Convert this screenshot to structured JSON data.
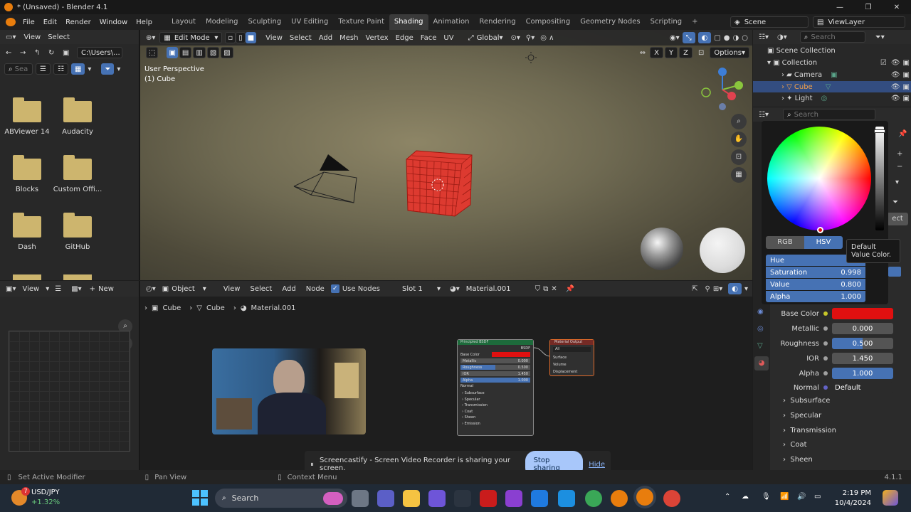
{
  "window": {
    "title": "* (Unsaved) - Blender 4.1"
  },
  "menu": [
    "File",
    "Edit",
    "Render",
    "Window",
    "Help"
  ],
  "workspaces": [
    "Layout",
    "Modeling",
    "Sculpting",
    "UV Editing",
    "Texture Paint",
    "Shading",
    "Animation",
    "Rendering",
    "Compositing",
    "Geometry Nodes",
    "Scripting"
  ],
  "active_workspace": "Shading",
  "scene": "Scene",
  "viewlayer": "ViewLayer",
  "filebrowser": {
    "view_label": "View",
    "select_label": "Select",
    "path": "C:\\Users\\...",
    "search_placeholder": "Sea",
    "folders": [
      "ABViewer 14",
      "Audacity",
      "Blocks",
      "Custom Offi...",
      "Dash",
      "GitHub"
    ]
  },
  "viewport": {
    "mode": "Edit Mode",
    "menus": [
      "View",
      "Select",
      "Add",
      "Mesh",
      "Vertex",
      "Edge",
      "Face",
      "UV"
    ],
    "orientation": "Global",
    "options_label": "Options",
    "overlay_line1": "User Perspective",
    "overlay_line2": "(1) Cube",
    "axes": [
      "X",
      "Y",
      "Z"
    ]
  },
  "outliner": {
    "search_placeholder": "Search",
    "root": "Scene Collection",
    "items": [
      "Collection",
      "Camera",
      "Cube",
      "Light"
    ]
  },
  "properties": {
    "search_placeholder": "Search",
    "mode_tabs": [
      "RGB",
      "HSV"
    ],
    "tooltip": "Default Value Color.",
    "hsv_fields": [
      {
        "label": "Hue",
        "value": "0"
      },
      {
        "label": "Saturation",
        "value": "0.998"
      },
      {
        "label": "Value",
        "value": "0.800"
      },
      {
        "label": "Alpha",
        "value": "1.000"
      }
    ],
    "rows": [
      {
        "label": "Base Color",
        "value": ""
      },
      {
        "label": "Metallic",
        "value": "0.000"
      },
      {
        "label": "Roughness",
        "value": "0.500"
      },
      {
        "label": "IOR",
        "value": "1.450"
      },
      {
        "label": "Alpha",
        "value": "1.000"
      },
      {
        "label": "Normal",
        "value": "Default"
      }
    ],
    "sections": [
      "Subsurface",
      "Specular",
      "Transmission",
      "Coat",
      "Sheen"
    ],
    "base_color": "#e01010",
    "side_label": "ect"
  },
  "image_editor": {
    "view_label": "View",
    "new_label": "New"
  },
  "node_editor": {
    "type": "Object",
    "menus": [
      "View",
      "Select",
      "Add",
      "Node"
    ],
    "use_nodes": "Use Nodes",
    "slot": "Slot 1",
    "material": "Material.001",
    "breadcrumb": [
      "Cube",
      "Cube",
      "Material.001"
    ],
    "bsdf": {
      "title": "Principled BSDF",
      "out": "BSDF",
      "rows": [
        "Base Color",
        "Metallic",
        "Roughness",
        "IOR",
        "Alpha",
        "Normal"
      ],
      "values": [
        "",
        "0.000",
        "0.500",
        "1.450",
        "1.000",
        ""
      ],
      "sections": [
        "Subsurface",
        "Specular",
        "Transmission",
        "Coat",
        "Sheen",
        "Emission"
      ]
    },
    "output": {
      "title": "Material Output",
      "target": "All",
      "sockets": [
        "Surface",
        "Volume",
        "Displacement"
      ]
    }
  },
  "screen_share": {
    "message": "Screencastify - Screen Video Recorder is sharing your screen.",
    "stop": "Stop sharing",
    "hide": "Hide"
  },
  "statusbar": {
    "left": "Set Active Modifier",
    "mid": "Pan View",
    "mid2": "Context Menu",
    "version": "4.1.1"
  },
  "taskbar": {
    "ticker": "USD/JPY",
    "change": "+1.32%",
    "badge": "7",
    "search": "Search",
    "time": "2:19 PM",
    "date": "10/4/2024",
    "accent": "#4672b4"
  }
}
